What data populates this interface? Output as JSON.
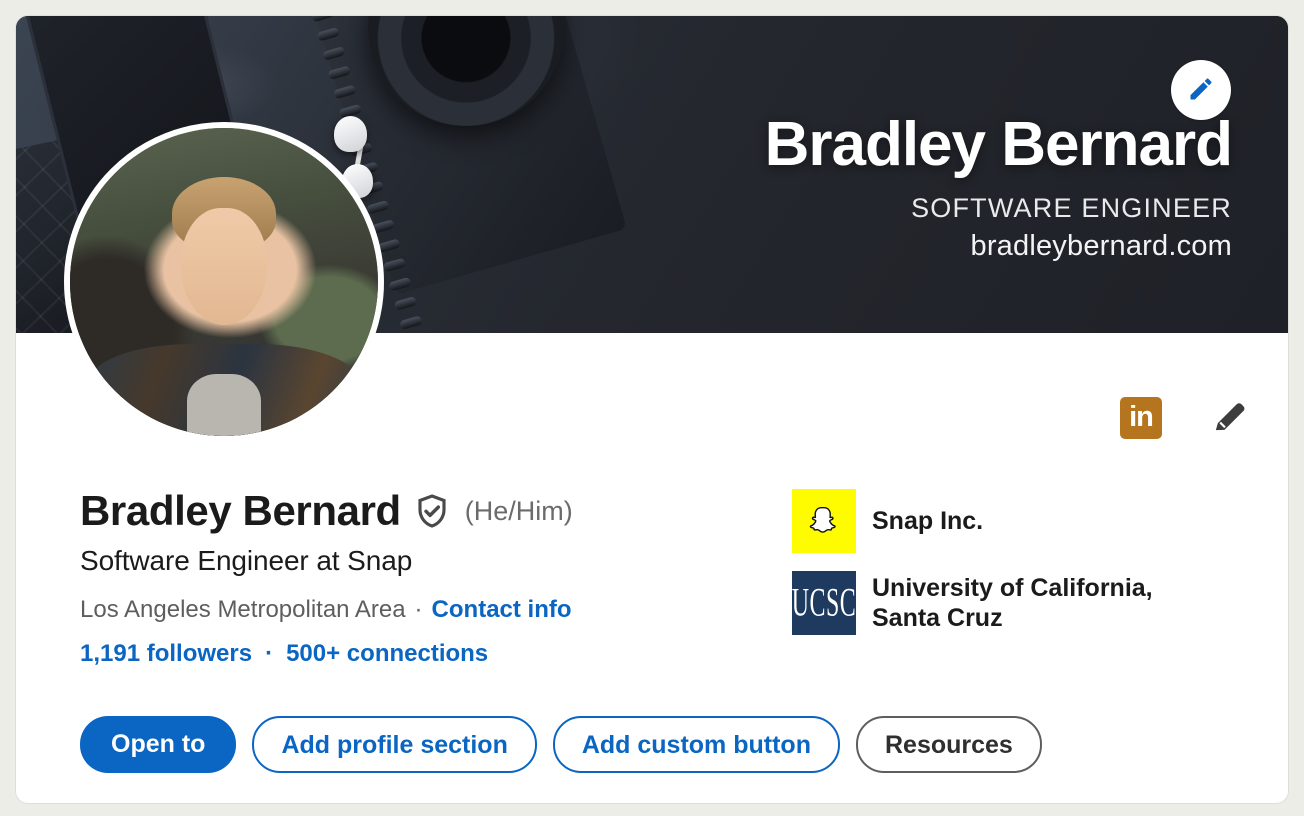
{
  "banner": {
    "name": "Bradley Bernard",
    "role": "SOFTWARE ENGINEER",
    "website": "bradleybernard.com",
    "edit_icon": "pencil-icon",
    "edit_icon_color": "#0A66C2",
    "background_color": "#24282F"
  },
  "avatar": {
    "alt": "profile-photo"
  },
  "top_actions": {
    "premium_badge_text": "in",
    "premium_badge_color": "#B5751F",
    "edit_icon": "pencil-icon"
  },
  "identity": {
    "full_name": "Bradley Bernard",
    "verified_icon": "verified-shield-icon",
    "pronouns": "(He/Him)",
    "headline": "Software Engineer at Snap",
    "location": "Los Angeles Metropolitan Area",
    "separator": "·",
    "contact_info": "Contact info",
    "followers": "1,191 followers",
    "stats_separator": "·",
    "connections": "500+ connections"
  },
  "buttons": [
    {
      "label": "Open to",
      "style": "primary"
    },
    {
      "label": "Add profile section",
      "style": "outline-blue"
    },
    {
      "label": "Add custom button",
      "style": "outline-blue"
    },
    {
      "label": "Resources",
      "style": "outline-gray"
    }
  ],
  "affiliations": [
    {
      "name": "Snap Inc.",
      "logo": "snapchat-ghost-icon",
      "logo_bg": "#FFFC00"
    },
    {
      "name": "University of California, Santa Cruz",
      "logo": "ucsc-logo-icon",
      "logo_bg": "#1E3A5F",
      "logo_text": "UCSC"
    }
  ],
  "colors": {
    "accent": "#0A66C2",
    "page_background": "#EDEDE8",
    "card_background": "#FFFFFF",
    "text_primary": "#1B1B1B",
    "text_secondary": "#5E5E5E"
  }
}
